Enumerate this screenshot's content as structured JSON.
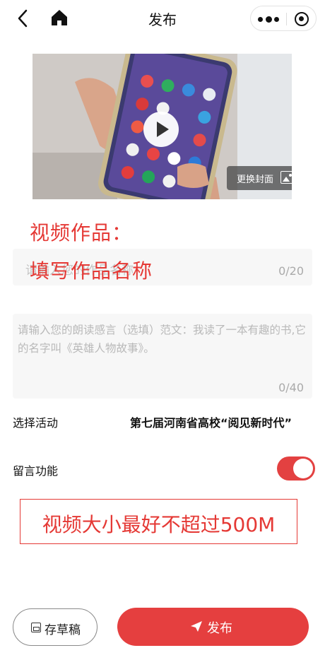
{
  "header": {
    "title": "发布",
    "icons": [
      "back-icon",
      "home-icon",
      "more-icon",
      "target-icon"
    ]
  },
  "cover": {
    "change_cover_label": "更换封面",
    "icons": [
      "play-icon",
      "image-icon"
    ]
  },
  "annotations": {
    "line1": "视频作品：",
    "line2": "填写作品名称",
    "boxed": "视频大小最好不超过500M"
  },
  "form": {
    "title_placeholder": "请输入您的作品名称",
    "title_count": "0/20",
    "desc_placeholder": "请输入您的朗读感言（选填）范文：我读了一本有趣的书,它的名字叫《英雄人物故事》。",
    "desc_count": "0/40",
    "activity_label": "选择活动",
    "activity_value": "第七届河南省高校“阅见新时代”",
    "comment_label": "留言功能",
    "comment_enabled": true
  },
  "footer": {
    "draft_label": "存草稿",
    "publish_label": "发布"
  },
  "colors": {
    "accent": "#e53f3f",
    "annotation": "#e53935"
  }
}
